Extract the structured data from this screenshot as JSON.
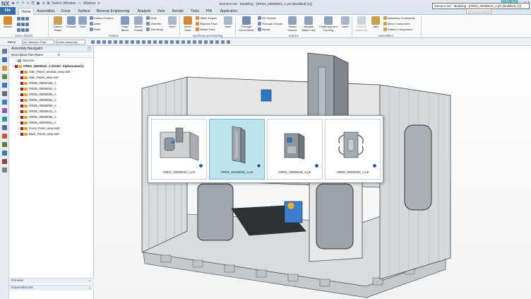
{
  "titlebar": {
    "logo": "NX",
    "switch_window": "Switch Window",
    "window_menu": "Window",
    "title": "Siemens NX - Modeling - [ORD4_00000010_A.prt (Modified)  (1)]",
    "brand": "SIEMENS",
    "window_controls": [
      "_",
      "□",
      "×"
    ]
  },
  "tabs": [
    "File",
    "Home",
    "Assemblies",
    "Curve",
    "Surface",
    "Reverse Engineering",
    "Analysis",
    "View",
    "Render",
    "Tools",
    "PMI",
    "Application"
  ],
  "active_tab": "Home",
  "find_command": {
    "placeholder": "Find a Command"
  },
  "tooltip": "Siemens NX - Modeling - [ORD4_00000010_A.prt (Modified)  (1)]",
  "ribbon": {
    "direct_sketch": {
      "label": "Direct Sketch",
      "sketch": "Sketch"
    },
    "feature": {
      "label": "Feature",
      "datum_plane": "Datum Plane",
      "extrude": "Extrude",
      "hole": "Hole",
      "pattern_feature": "Pattern Feature",
      "unite": "Unite",
      "shell": "Shell",
      "edge_blend": "Edge Blend",
      "blend_pocket": "Blend Pocket",
      "draft": "Draft",
      "chamfer": "Chamfer",
      "trim_body": "Trim Body",
      "more": "More"
    },
    "synchronous": {
      "label": "Synchronous Modeling",
      "move_face": "Move Face",
      "offset_region": "Offset Region",
      "replace_face": "Replace Face",
      "delete_face": "Delete Face",
      "more": "More"
    },
    "surface": {
      "label": "Surface",
      "through_curve_mesh": "Through Curve Mesh",
      "fill_surface": "Fill Surface",
      "through_curves": "Through Curves",
      "swept": "Swept",
      "swept_volume": "Swept Volume",
      "variable_offset_face": "Variable Offset Face",
      "flattening_forming": "Flattening and Forming",
      "more": "More"
    },
    "assemblies": {
      "label": "Assemblies",
      "work_on_assembly": "Work on Assembly",
      "add": "Add",
      "assembly_constraints": "Assembly Constraints",
      "move_component": "Move Component",
      "pattern_component": "Pattern Component"
    }
  },
  "selection_bar": {
    "menu": "Menu",
    "filter": "No Selection Filter",
    "scope": "Entire Assembly"
  },
  "navigator": {
    "title": "Assembly Navigator",
    "column": "Descriptive Part Name",
    "rows": [
      {
        "label": "Sections",
        "kind": "section",
        "indent": 1
      },
      {
        "label": "ORD4_00000010_A (Order: Alphanumeric)",
        "kind": "root",
        "indent": 0
      },
      {
        "label": "Side_Panel_window_assy.vw0",
        "kind": "asm",
        "indent": 2
      },
      {
        "label": "Side_Panel_assy.vw0",
        "kind": "asm",
        "indent": 2
      },
      {
        "label": "ORD5_00000165_A",
        "kind": "asm",
        "indent": 2
      },
      {
        "label": "ORD5_00000062_A",
        "kind": "asm",
        "indent": 2
      },
      {
        "label": "ORD5_00000056_A",
        "kind": "asm",
        "indent": 2
      },
      {
        "label": "ORD5_00000053_A",
        "kind": "asm",
        "indent": 2
      },
      {
        "label": "ORD5_00000050_A",
        "kind": "asm",
        "indent": 2
      },
      {
        "label": "ORD5_00000042_A",
        "kind": "asm",
        "indent": 2
      },
      {
        "label": "ORD5_00000035_A",
        "kind": "asm",
        "indent": 2
      },
      {
        "label": "ORD5_00000011_A",
        "kind": "asm",
        "indent": 2
      },
      {
        "label": "Front_Panel_assy.vw0",
        "kind": "asm",
        "indent": 2
      },
      {
        "label": "Back_Panel_assy.vw0",
        "kind": "asm",
        "indent": 2
      }
    ],
    "preview": "Preview",
    "dependencies": "Dependencies"
  },
  "part_popup": [
    {
      "name": "ORD4_00000010_A.prt",
      "selected": false
    },
    {
      "name": "ORD5_00000043_A.prt",
      "selected": true
    },
    {
      "name": "ORD5_00000042_A.prt",
      "selected": false
    },
    {
      "name": "ORD5_00000062_A.prt",
      "selected": false
    }
  ],
  "colors": {
    "accent": "#3a6ea5",
    "tab_bg": "#dde6ef",
    "selection_highlight": "#bde3ef",
    "brand": "#009999"
  }
}
